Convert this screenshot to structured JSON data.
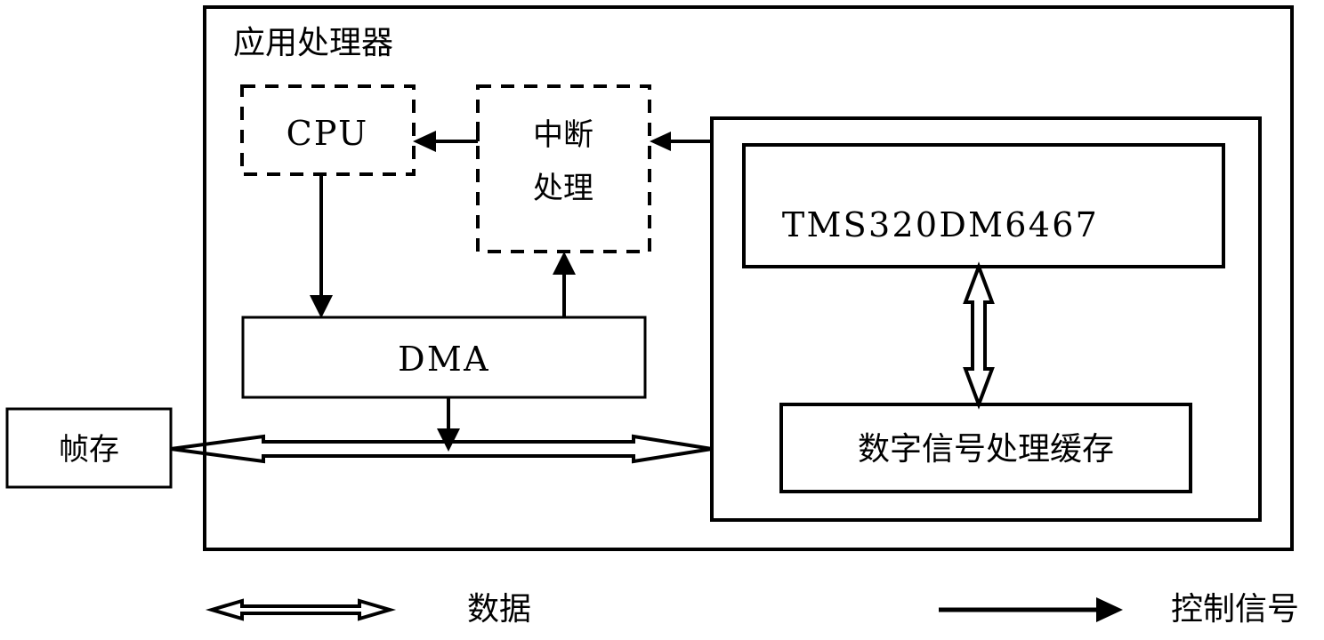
{
  "diagram": {
    "type": "block-diagram",
    "title": "应用处理器",
    "blocks": {
      "application_processor": {
        "label": "应用处理器",
        "border_style": "solid",
        "note": "outer container"
      },
      "cpu": {
        "label": "CPU",
        "border_style": "dashed"
      },
      "interrupt_handler": {
        "label_line1": "中断",
        "label_line2": "处理",
        "border_style": "dashed"
      },
      "dma": {
        "label": "DMA",
        "border_style": "solid"
      },
      "frame_store": {
        "label": "帧存",
        "border_style": "solid"
      },
      "dsp_board": {
        "label": "",
        "border_style": "solid",
        "note": "outer DSP subsystem container"
      },
      "dsp_chip": {
        "label": "TMS320DM6467",
        "border_style": "solid"
      },
      "dsp_buffer": {
        "label": "数字信号处理缓存",
        "border_style": "solid"
      }
    },
    "connections": [
      {
        "from": "dsp_board",
        "to": "interrupt_handler",
        "kind": "control",
        "arrow": "single",
        "direction": "left"
      },
      {
        "from": "interrupt_handler",
        "to": "cpu",
        "kind": "control",
        "arrow": "single",
        "direction": "left"
      },
      {
        "from": "cpu",
        "to": "dma",
        "kind": "control",
        "arrow": "single",
        "direction": "down"
      },
      {
        "from": "dma",
        "to": "interrupt_handler",
        "kind": "control",
        "arrow": "single",
        "direction": "up"
      },
      {
        "from": "dma",
        "to": "data_bus",
        "kind": "control",
        "arrow": "single",
        "direction": "down"
      },
      {
        "from": "frame_store",
        "to": "dsp_board",
        "kind": "data",
        "arrow": "double",
        "direction": "horizontal"
      },
      {
        "from": "dsp_chip",
        "to": "dsp_buffer",
        "kind": "data",
        "arrow": "double",
        "direction": "vertical"
      }
    ]
  },
  "legend": {
    "items": [
      {
        "symbol": "hollow-double-arrow",
        "label": "数据"
      },
      {
        "symbol": "solid-single-arrow",
        "label": "控制信号"
      }
    ]
  },
  "colors": {
    "stroke": "#000000",
    "background": "#ffffff"
  }
}
